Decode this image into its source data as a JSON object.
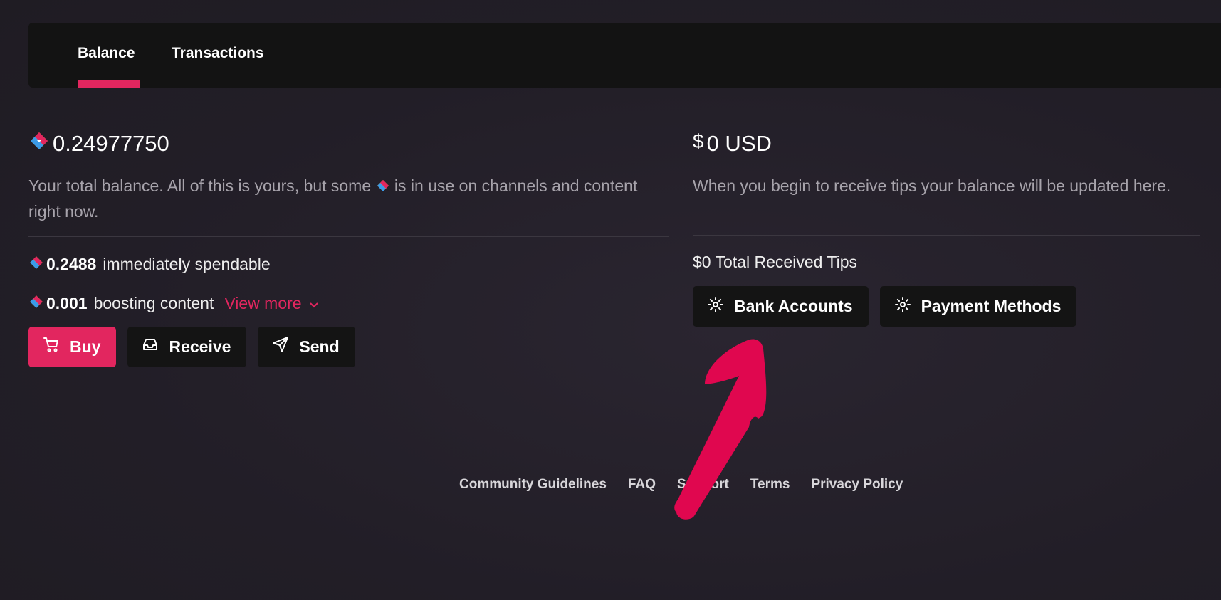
{
  "tabs": [
    {
      "label": "Balance",
      "active": true
    },
    {
      "label": "Transactions",
      "active": false
    }
  ],
  "lbc": {
    "balance": "0.24977750",
    "description_pre": "Your total balance. All of this is yours, but some",
    "description_post": "is in use on channels and content right now.",
    "spendable_value": "0.2488",
    "spendable_label": "immediately spendable",
    "boosting_value": "0.001",
    "boosting_label": "boosting content",
    "view_more": "View more"
  },
  "usd": {
    "currency_symbol": "$",
    "balance": "0 USD",
    "description": "When you begin to receive tips your balance will be updated here.",
    "received_tips": "$0 Total Received Tips"
  },
  "buttons": {
    "buy": "Buy",
    "receive": "Receive",
    "send": "Send",
    "bank_accounts": "Bank Accounts",
    "payment_methods": "Payment Methods"
  },
  "footer": [
    "Community Guidelines",
    "FAQ",
    "Support",
    "Terms",
    "Privacy Policy"
  ],
  "colors": {
    "accent": "#e2265f",
    "background": "#221e27",
    "panel": "#131313"
  },
  "icons": {
    "lbc": "lbc-credits-icon",
    "buy": "cart-icon",
    "receive": "inbox-icon",
    "send": "send-icon",
    "settings": "gear-icon",
    "view_more": "chevron-down-icon",
    "annotation": "arrow-annotation"
  }
}
